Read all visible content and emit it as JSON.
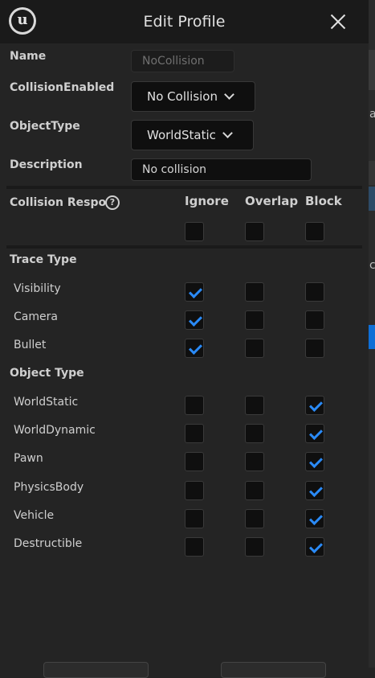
{
  "dialog": {
    "title": "Edit Profile",
    "logo_glyph": "u"
  },
  "fields": {
    "name_label": "Name",
    "name_value": "NoCollision",
    "collision_enabled_label": "CollisionEnabled",
    "collision_enabled_value": "No Collision",
    "object_type_label": "ObjectType",
    "object_type_value": "WorldStatic",
    "description_label": "Description",
    "description_value": "No collision"
  },
  "responses": {
    "header_label": "Collision Respo",
    "help_glyph": "?",
    "columns": [
      "Ignore",
      "Overlap",
      "Block"
    ],
    "all_row": [
      false,
      false,
      false
    ]
  },
  "trace_type": {
    "label": "Trace Type",
    "rows": [
      {
        "name": "Visibility",
        "ignore": true,
        "overlap": false,
        "block": false
      },
      {
        "name": "Camera",
        "ignore": true,
        "overlap": false,
        "block": false
      },
      {
        "name": "Bullet",
        "ignore": true,
        "overlap": false,
        "block": false
      }
    ]
  },
  "object_type": {
    "label": "Object Type",
    "rows": [
      {
        "name": "WorldStatic",
        "ignore": false,
        "overlap": false,
        "block": true
      },
      {
        "name": "WorldDynamic",
        "ignore": false,
        "overlap": false,
        "block": true
      },
      {
        "name": "Pawn",
        "ignore": false,
        "overlap": false,
        "block": true
      },
      {
        "name": "PhysicsBody",
        "ignore": false,
        "overlap": false,
        "block": true
      },
      {
        "name": "Vehicle",
        "ignore": false,
        "overlap": false,
        "block": true
      },
      {
        "name": "Destructible",
        "ignore": false,
        "overlap": false,
        "block": true
      }
    ]
  },
  "background_glyphs": [
    "a",
    "c"
  ],
  "colors": {
    "accent": "#2a8af6",
    "background": "#242424",
    "titlebar": "#1a1a1a",
    "field": "#0f0f0f"
  }
}
